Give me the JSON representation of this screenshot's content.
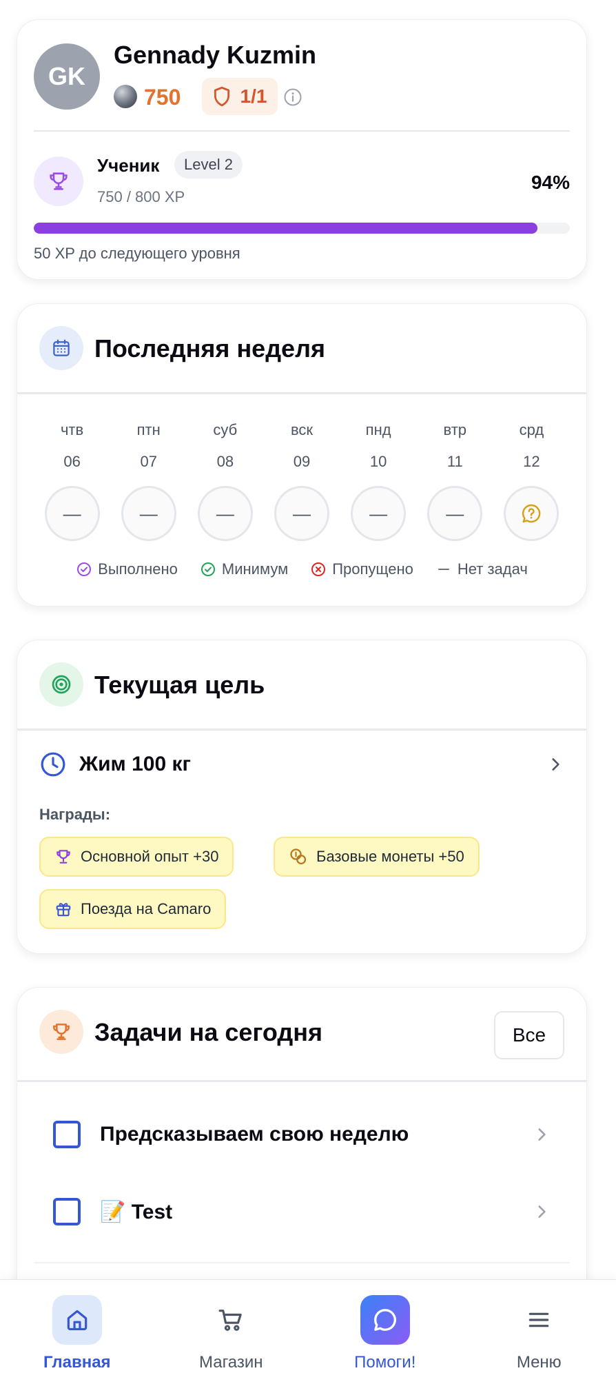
{
  "profile": {
    "initials": "GK",
    "name": "Gennady Kuzmin",
    "coins": "750",
    "shields": "1/1",
    "level_title": "Ученик",
    "level_badge": "Level 2",
    "xp": "750 / 800 XP",
    "xp_percent": "94%",
    "xp_progress": 0.94,
    "xp_next": "50 XP до следующего уровня"
  },
  "week": {
    "title": "Последняя неделя",
    "days": [
      {
        "name": "чтв",
        "num": "06",
        "mark": "—"
      },
      {
        "name": "птн",
        "num": "07",
        "mark": "—"
      },
      {
        "name": "суб",
        "num": "08",
        "mark": "—"
      },
      {
        "name": "вск",
        "num": "09",
        "mark": "—"
      },
      {
        "name": "пнд",
        "num": "10",
        "mark": "—"
      },
      {
        "name": "втр",
        "num": "11",
        "mark": "—"
      },
      {
        "name": "срд",
        "num": "12",
        "mark": ""
      }
    ],
    "legend": {
      "done": "Выполнено",
      "minimum": "Минимум",
      "missed": "Пропущено",
      "none": "Нет задач"
    }
  },
  "goal": {
    "title": "Текущая цель",
    "name": "Жим 100 кг",
    "rewards_label": "Награды:",
    "rewards": [
      {
        "label": "Основной опыт +30",
        "icon": "trophy-icon"
      },
      {
        "label": "Базовые монеты +50",
        "icon": "coins-icon"
      },
      {
        "label": "Поезда на Camaro",
        "icon": "gift-icon"
      }
    ]
  },
  "tasks": {
    "title": "Задачи на сегодня",
    "all_label": "Все",
    "items": [
      {
        "title": "Предсказываем свою неделю"
      },
      {
        "title": "📝 Test"
      }
    ]
  },
  "nav": {
    "home": "Главная",
    "shop": "Магазин",
    "help": "Помоги!",
    "menu": "Меню"
  },
  "colors": {
    "accent": "#3557d6",
    "progress": "#8b3fe0",
    "coins": "#e2732e",
    "reward_bg": "#fef9c3"
  }
}
